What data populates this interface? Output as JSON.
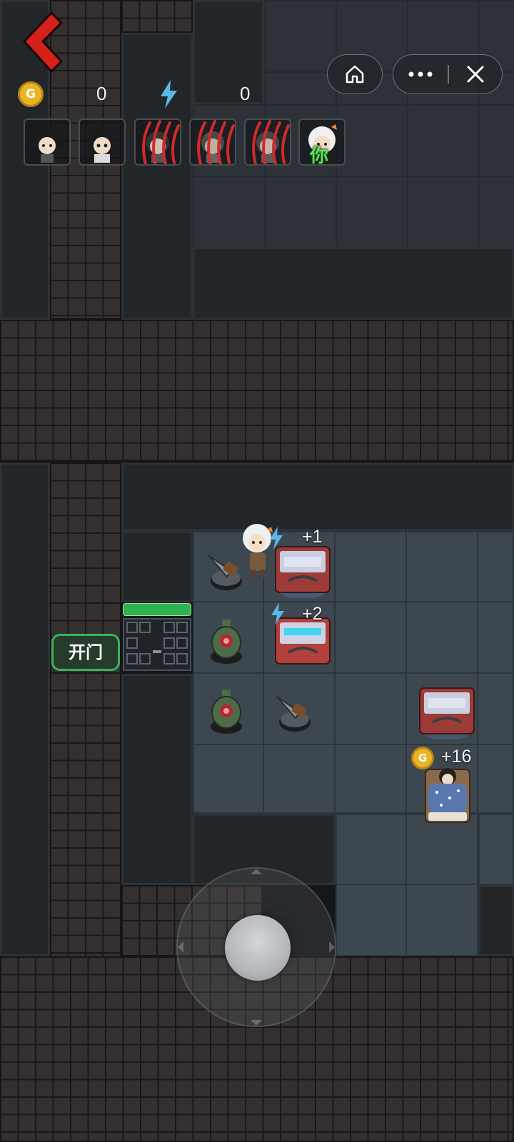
{
  "hud": {
    "coins": "0",
    "energy": "0",
    "coin_symbol": "G"
  },
  "roster": [
    {
      "name": "girl-twintails",
      "status": "alive"
    },
    {
      "name": "girl-dark-hair",
      "status": "alive"
    },
    {
      "name": "victim-1",
      "status": "clawed"
    },
    {
      "name": "victim-2",
      "status": "clawed"
    },
    {
      "name": "victim-3",
      "status": "clawed"
    },
    {
      "name": "player-white-hair",
      "status": "you",
      "badge": "你"
    }
  ],
  "room": {
    "door_button_label": "开门",
    "door_hp_color": "#2fb24f",
    "energy_gain_1": "+1",
    "energy_gain_2": "+2",
    "coin_gain": "+16",
    "coin_symbol": "G"
  },
  "colors": {
    "back_arrow": "#d6211b",
    "coin": "#e9b524",
    "bolt": "#5ab8e8",
    "claw": "#d12a2a",
    "button_border": "#3bb35a"
  },
  "icons": {
    "back": "chevron-left-icon",
    "home": "home-icon",
    "more": "more-dots-icon",
    "close": "close-icon"
  }
}
